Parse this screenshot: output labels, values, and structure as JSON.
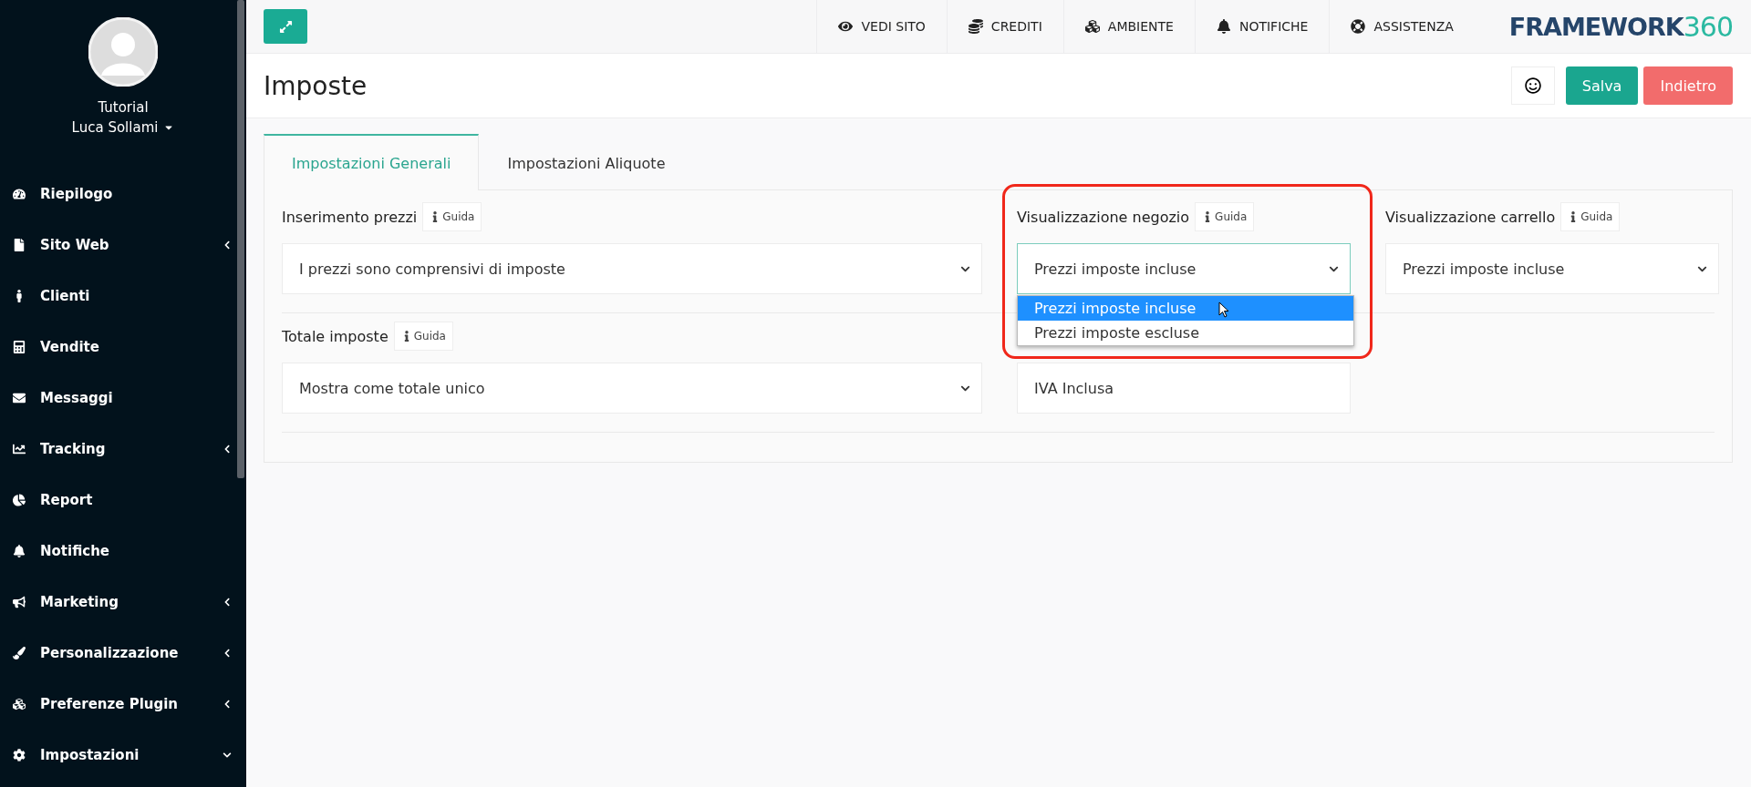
{
  "user": {
    "line1": "Tutorial",
    "line2": "Luca Sollami"
  },
  "sidebar": {
    "items": [
      {
        "label": "Riepilogo",
        "kind": "link"
      },
      {
        "label": "Sito Web",
        "kind": "group",
        "expanded": false
      },
      {
        "label": "Clienti",
        "kind": "link"
      },
      {
        "label": "Vendite",
        "kind": "link"
      },
      {
        "label": "Messaggi",
        "kind": "link"
      },
      {
        "label": "Tracking",
        "kind": "group",
        "expanded": false
      },
      {
        "label": "Report",
        "kind": "link"
      },
      {
        "label": "Notifiche",
        "kind": "link"
      },
      {
        "label": "Marketing",
        "kind": "group",
        "expanded": false
      },
      {
        "label": "Personalizzazione",
        "kind": "group",
        "expanded": false
      },
      {
        "label": "Preferenze Plugin",
        "kind": "group",
        "expanded": false
      },
      {
        "label": "Impostazioni",
        "kind": "group",
        "expanded": true
      }
    ]
  },
  "topbar": {
    "links": [
      "VEDI SITO",
      "CREDITI",
      "AMBIENTE",
      "NOTIFICHE",
      "ASSISTENZA"
    ],
    "logo": {
      "word": "FRAMEWORK",
      "number": "360"
    }
  },
  "page": {
    "title": "Imposte",
    "buttons": [
      {
        "label": "Salva",
        "kind": "primary"
      },
      {
        "label": "Indietro",
        "kind": "danger"
      }
    ]
  },
  "tabs": [
    {
      "label": "Impostazioni Generali",
      "selected": true
    },
    {
      "label": "Impostazioni Aliquote",
      "selected": false
    }
  ],
  "rows": [
    [
      {
        "label": "Inserimento prezzi",
        "guide": "Guida",
        "kind": "select",
        "value": "I prezzi sono comprensivi di imposte",
        "focused": false
      },
      {
        "label": "Visualizzazione negozio",
        "guide": "Guida",
        "kind": "select",
        "value": "Prezzi imposte incluse",
        "focused": true,
        "highlighted": true,
        "options": [
          {
            "label": "Prezzi imposte incluse",
            "selected": true
          },
          {
            "label": "Prezzi imposte escluse",
            "selected": false
          }
        ]
      },
      {
        "label": "Visualizzazione carrello",
        "guide": "Guida",
        "kind": "select",
        "value": "Prezzi imposte incluse",
        "focused": false
      }
    ],
    [
      {
        "label": "Totale imposte",
        "guide": "Guida",
        "kind": "select",
        "value": "Mostra come totale unico",
        "focused": false
      },
      {
        "kind": "text",
        "value": "IVA Inclusa",
        "focused": false
      }
    ]
  ]
}
